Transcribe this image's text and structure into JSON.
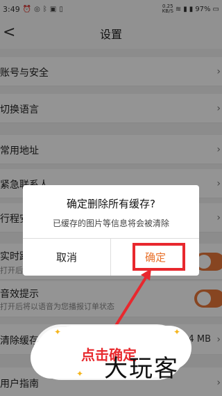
{
  "status": {
    "time": "3:49",
    "speed": "0.25",
    "speed_unit": "KB/S",
    "battery": "97%"
  },
  "nav": {
    "back": "<",
    "title": "设置"
  },
  "rows": [
    {
      "label": "账号与安全"
    },
    {
      "label": "切换语言"
    },
    {
      "label": "常用地址"
    },
    {
      "label": "紧急联系人"
    },
    {
      "label": "行程安全"
    },
    {
      "label": "实时路况",
      "sub": "打开后"
    },
    {
      "label": "音效提示",
      "sub": "打开后将以语音为您播报订单状态"
    },
    {
      "label": "清除缓存",
      "value": "4 MB"
    },
    {
      "label": "用户指南"
    }
  ],
  "dialog": {
    "title": "确定删除所有缓存?",
    "message": "已缓存的图片等信息将会被清除",
    "cancel": "取消",
    "confirm": "确定"
  },
  "annotation": {
    "callout": "点击确定",
    "watermark": "大玩客"
  },
  "colors": {
    "accent": "#e8773a",
    "highlight": "#e8282e"
  }
}
